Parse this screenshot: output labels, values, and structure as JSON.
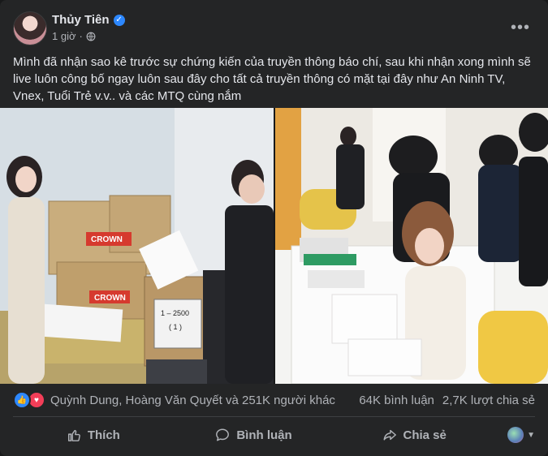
{
  "post": {
    "author": "Thủy Tiên",
    "time": "1 giờ",
    "more_label": "•••",
    "text": "Mình đã nhận sao kê trước sự chứng kiến của truyền thông báo chí, sau khi nhận xong mình sẽ live luôn công bố ngay luôn sau đây cho tất cả truyền thông có mặt tại đây như An Ninh TV, Vnex, Tuổi Trẻ v.v.. và các MTQ cùng nắm",
    "icons": {
      "verified": "verified-badge-icon",
      "privacy": "globe-icon"
    }
  },
  "photos": {
    "left_box_brand": "CROWN",
    "left_box_brand_2": "CROWN",
    "left_box_label_line1": "1 – 2500",
    "left_box_label_line2": "( 1 )"
  },
  "reactions": {
    "names": "Quỳnh Dung, Hoàng Văn Quyết và 251K người khác",
    "comments": "64K bình luận",
    "shares": "2,7K lượt chia sẻ"
  },
  "actions": {
    "like": "Thích",
    "comment": "Bình luận",
    "share": "Chia sẻ"
  },
  "colors": {
    "background": "#242526",
    "text": "#e4e6eb",
    "muted": "#b0b3b8",
    "accent": "#2d88ff"
  }
}
